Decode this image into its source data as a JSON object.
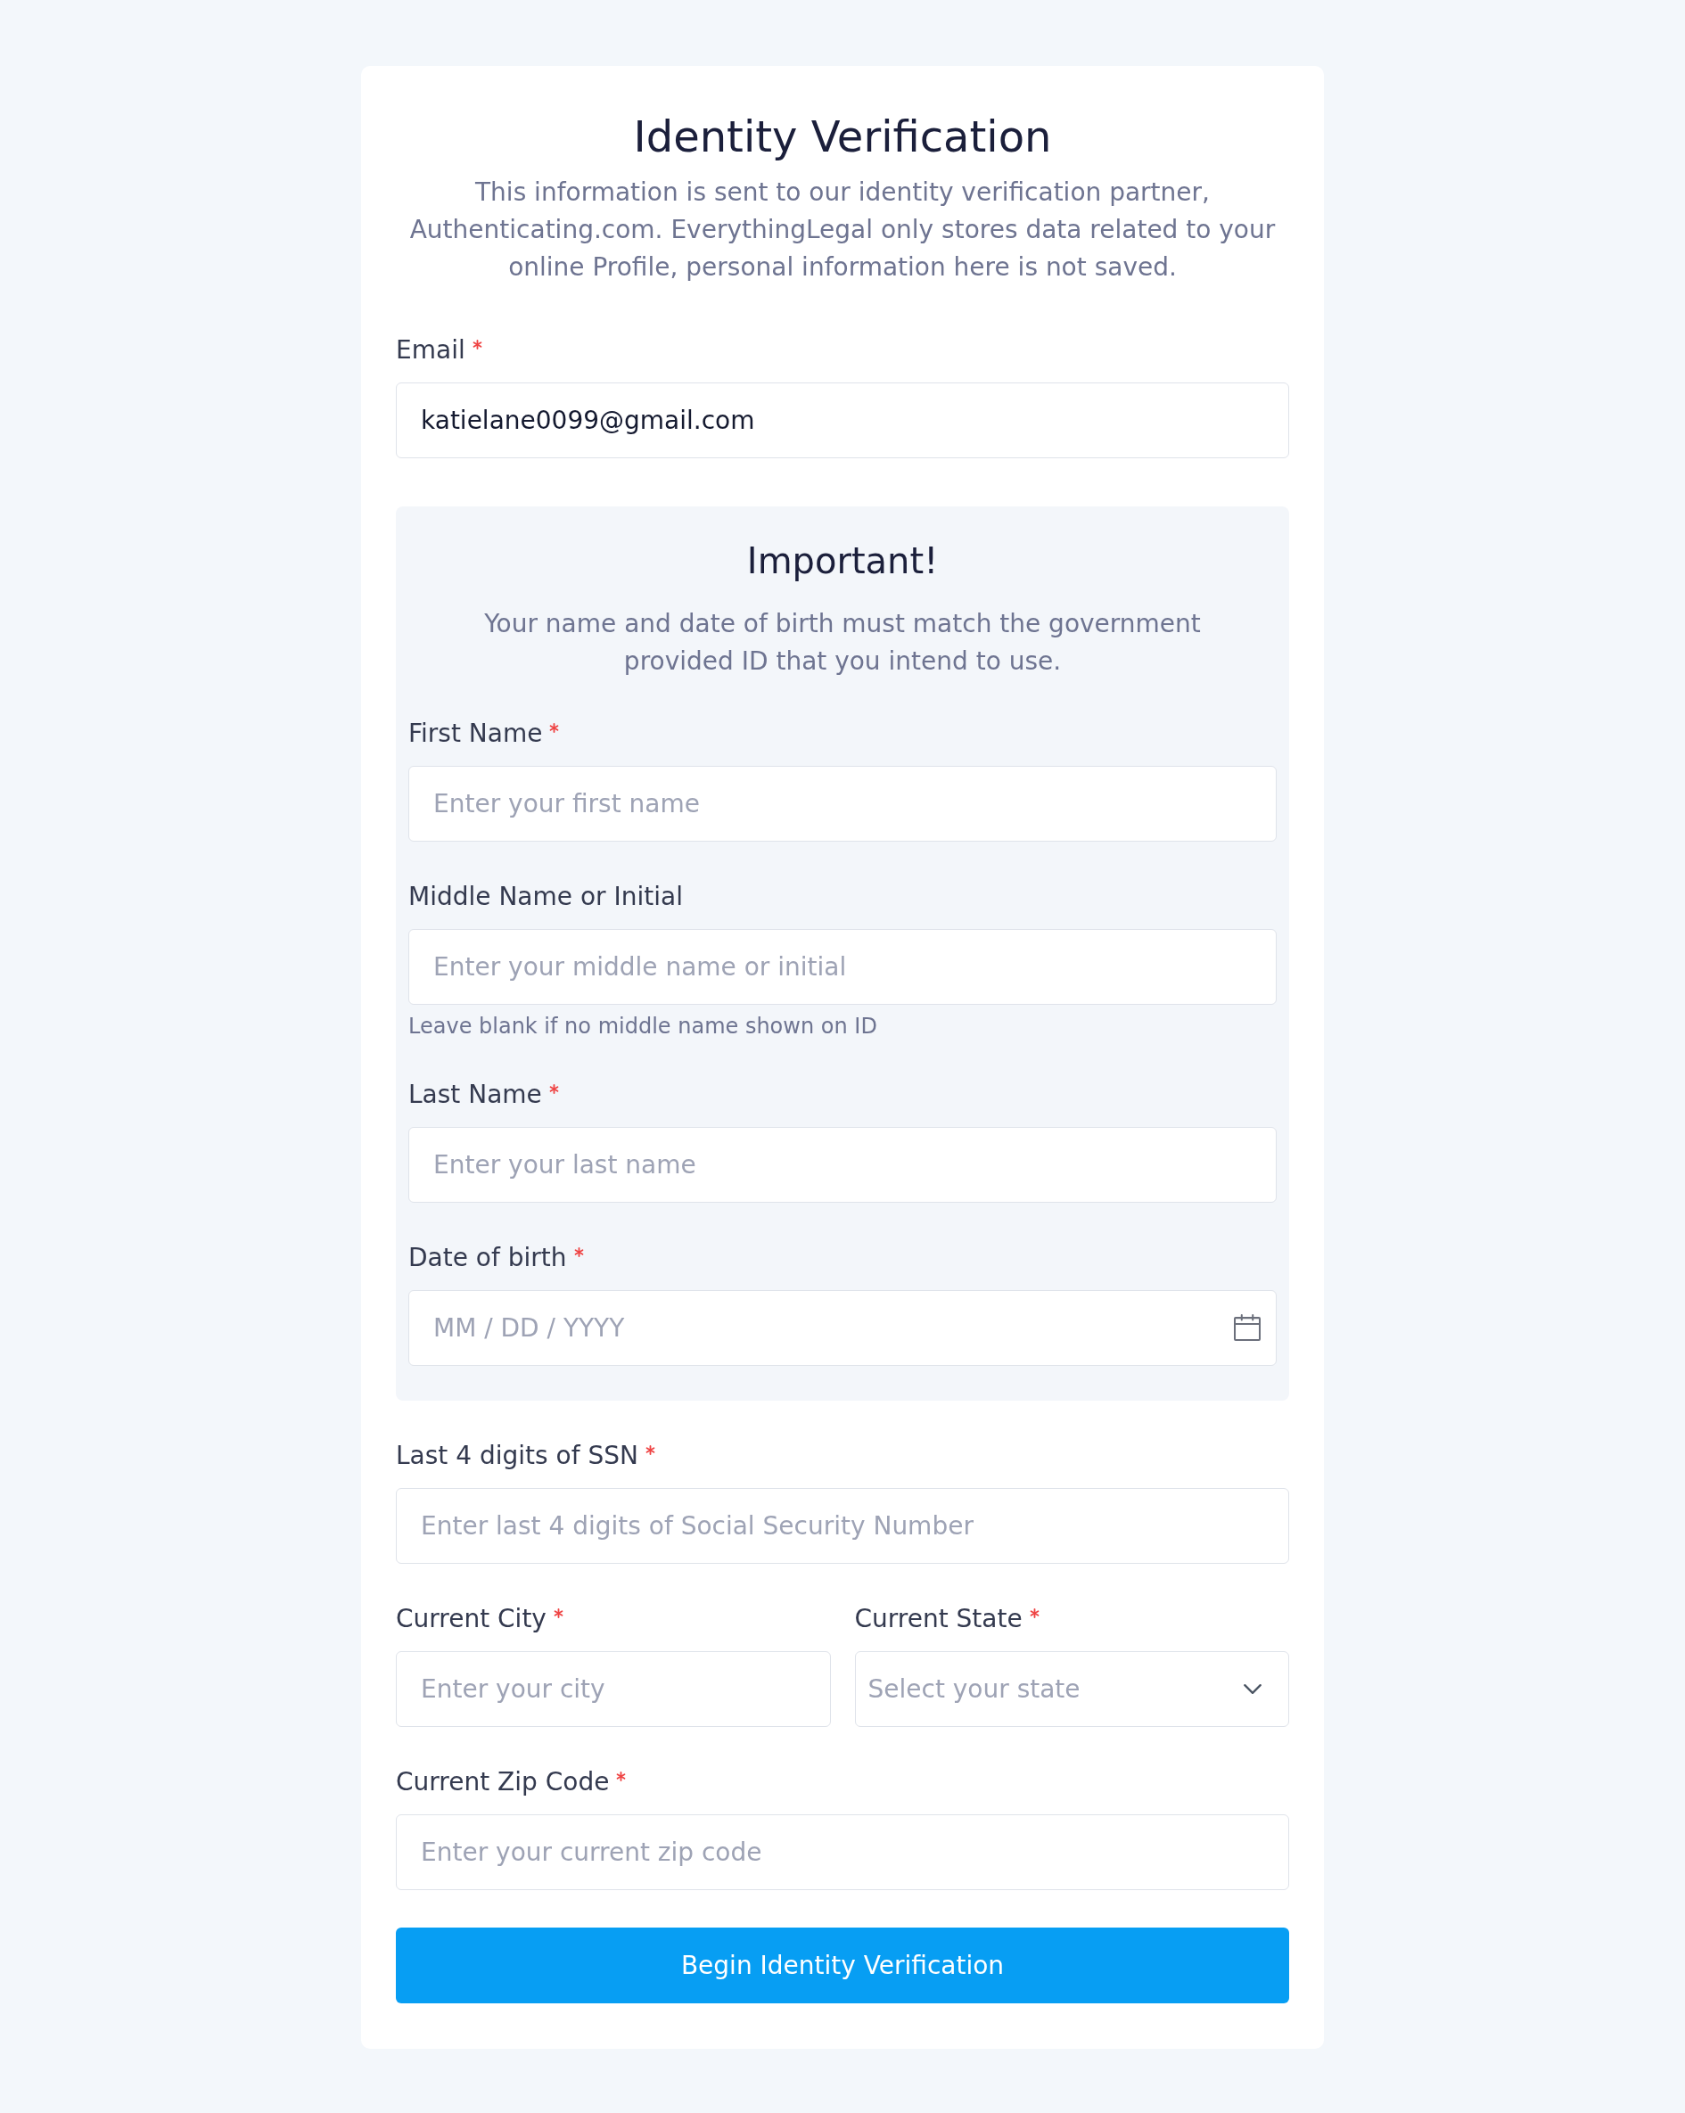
{
  "header": {
    "title": "Identity Verification",
    "description": "This information is sent to our identity verification partner, Authenticating.com. EverythingLegal only stores data related to your online Profile, personal information here is not saved."
  },
  "email_field": {
    "kind": "text",
    "label": "Email",
    "required": true,
    "value": "katielane0099@gmail.com"
  },
  "notice": {
    "title": "Important!",
    "text": "Your name and date of birth must match the government provided ID that you intend to use.",
    "fields": [
      {
        "kind": "text",
        "label": "First Name",
        "required": true,
        "placeholder": "Enter your first name"
      },
      {
        "kind": "text",
        "label": "Middle Name or Initial",
        "required": false,
        "placeholder": "Enter your middle name or initial",
        "hint": "Leave blank if no middle name shown on ID"
      },
      {
        "kind": "text",
        "label": "Last Name",
        "required": true,
        "placeholder": "Enter your last name"
      },
      {
        "kind": "date",
        "label": "Date of birth",
        "required": true,
        "placeholder": "MM / DD / YYYY"
      }
    ]
  },
  "fields": [
    {
      "kind": "text",
      "label": "Last 4 digits of SSN",
      "required": true,
      "placeholder": "Enter last 4 digits of Social Security Number"
    },
    {
      "kind": "row",
      "fields": [
        {
          "kind": "text",
          "label": "Current City",
          "required": true,
          "placeholder": "Enter your city"
        },
        {
          "kind": "select",
          "label": "Current State",
          "required": true,
          "placeholder": "Select your state"
        }
      ]
    },
    {
      "kind": "text",
      "label": "Current Zip Code",
      "required": true,
      "placeholder": "Enter your current zip code"
    }
  ],
  "submit_button": {
    "label": "Begin Identity Verification"
  }
}
